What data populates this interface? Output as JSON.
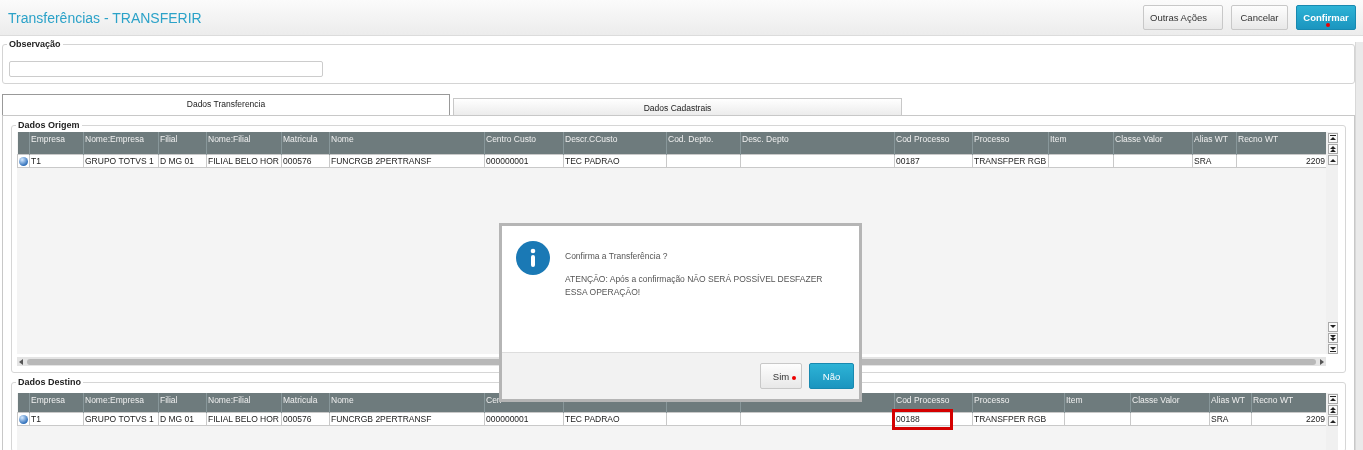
{
  "window": {
    "title": "Transferências - TRANSFERIR"
  },
  "toolbar": {
    "buttons": [
      {
        "label": "Outras Ações",
        "kind": "menu",
        "red_dot": false
      },
      {
        "label": "Cancelar",
        "kind": "plain",
        "red_dot": false
      },
      {
        "label": "Confirmar",
        "kind": "primary",
        "red_dot": true
      }
    ]
  },
  "observacao": {
    "label": "Observação"
  },
  "tabs": [
    {
      "label": "Dados Transferencia",
      "selected": true
    },
    {
      "label": "Dados Cadastrais",
      "selected": false
    }
  ],
  "origem": {
    "title": "Dados Origem",
    "columns": [
      {
        "header": "Empresa"
      },
      {
        "header": "Nome:Empresa"
      },
      {
        "header": "Filial"
      },
      {
        "header": "Nome:Filial"
      },
      {
        "header": "Matricula"
      },
      {
        "header": "Nome"
      },
      {
        "header": "Centro Custo"
      },
      {
        "header": "Descr.CCusto"
      },
      {
        "header": "Cod. Depto."
      },
      {
        "header": "Desc. Depto"
      },
      {
        "header": "Cod Processo"
      },
      {
        "header": "Processo"
      },
      {
        "header": "Item"
      },
      {
        "header": "Classe Valor"
      },
      {
        "header": "Alias WT"
      },
      {
        "header": "Recno WT"
      }
    ],
    "rows": [
      {
        "cells": [
          {
            "text": "T1",
            "highlighted": false
          },
          {
            "text": "GRUPO TOTVS 1",
            "highlighted": false
          },
          {
            "text": "D MG 01",
            "highlighted": false
          },
          {
            "text": "FILIAL BELO HOR",
            "highlighted": false
          },
          {
            "text": "000576",
            "highlighted": false
          },
          {
            "text": "FUNCRGB 2PERTRANSF",
            "highlighted": false
          },
          {
            "text": "000000001",
            "highlighted": false
          },
          {
            "text": "TEC PADRAO",
            "highlighted": false
          },
          {
            "highlighted": false
          },
          {
            "highlighted": false
          },
          {
            "text": "00187",
            "highlighted": false
          },
          {
            "text": "TRANSFPER RGB",
            "highlighted": false
          },
          {
            "highlighted": false
          },
          {
            "highlighted": false
          },
          {
            "text": "SRA",
            "highlighted": false
          },
          {
            "text": "2209",
            "highlighted": false
          }
        ]
      }
    ]
  },
  "destino": {
    "title": "Dados Destino",
    "columns": [
      {
        "header": "Empresa"
      },
      {
        "header": "Nome:Empresa"
      },
      {
        "header": "Filial"
      },
      {
        "header": "Nome:Filial"
      },
      {
        "header": "Matricula"
      },
      {
        "header": "Nome"
      },
      {
        "header": "Cen"
      },
      {},
      {},
      {},
      {
        "header": "Cod Processo"
      },
      {
        "header": "Processo"
      },
      {
        "header": "Item"
      },
      {
        "header": "Classe Valor"
      },
      {
        "header": "Alias WT"
      },
      {
        "header": "Recno WT"
      }
    ],
    "rows": [
      {
        "cells": [
          {
            "text": "T1",
            "highlighted": false
          },
          {
            "text": "GRUPO TOTVS 1",
            "highlighted": false
          },
          {
            "text": "D MG 01",
            "highlighted": false
          },
          {
            "text": "FILIAL BELO HOR",
            "highlighted": false
          },
          {
            "text": "000576",
            "highlighted": false
          },
          {
            "text": "FUNCRGB 2PERTRANSF",
            "highlighted": false
          },
          {
            "text": "000000001",
            "highlighted": false
          },
          {
            "text": "TEC PADRAO",
            "highlighted": false
          },
          {
            "highlighted": false
          },
          {
            "highlighted": false
          },
          {
            "text": "00188",
            "highlighted": true
          },
          {
            "text": "TRANSFPER RGB",
            "highlighted": false
          },
          {
            "highlighted": false
          },
          {
            "highlighted": false
          },
          {
            "text": "SRA",
            "highlighted": false
          },
          {
            "text": "2209",
            "highlighted": false
          }
        ]
      }
    ]
  },
  "dialog": {
    "title": "Confirma a Transferência ?",
    "message": "ATENÇÃO: Após a confirmação NÃO SERÁ POSSÍVEL DESFAZER ESSA OPERAÇÃO!",
    "buttons": [
      {
        "label": "Sim",
        "kind": "plain",
        "red_dot": true
      },
      {
        "label": "Não",
        "kind": "primary",
        "red_dot": false
      }
    ]
  }
}
